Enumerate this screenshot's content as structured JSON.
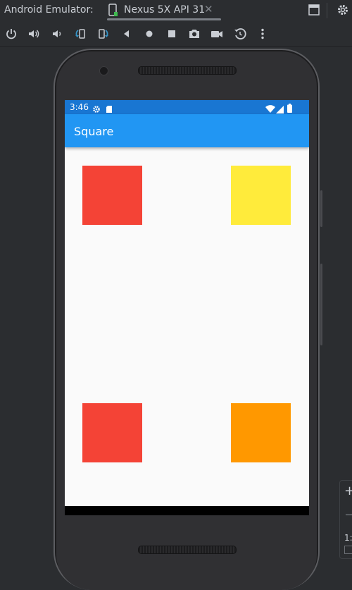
{
  "window": {
    "title": "Android Emulator:",
    "device_tab": "Nexus 5X API 31"
  },
  "toolbar": {
    "icons": [
      "power-icon",
      "volume-up-icon",
      "volume-down-icon",
      "rotate-left-icon",
      "rotate-right-icon",
      "back-icon",
      "home-icon",
      "overview-icon",
      "screenshot-icon",
      "screen-record-icon",
      "snapshot-icon",
      "more-icon"
    ]
  },
  "device": {
    "status": {
      "time": "3:46"
    },
    "app": {
      "title": "Square"
    },
    "squares": [
      {
        "color": "#f44336"
      },
      {
        "color": "#ffeb3b"
      },
      {
        "color": "#f44336"
      },
      {
        "color": "#ff9800"
      }
    ]
  },
  "zoom": {
    "plus": "+",
    "minus": "−",
    "ratio": "1:"
  },
  "colors": {
    "statusbar": "#1976d2",
    "appbar": "#2196f3"
  }
}
